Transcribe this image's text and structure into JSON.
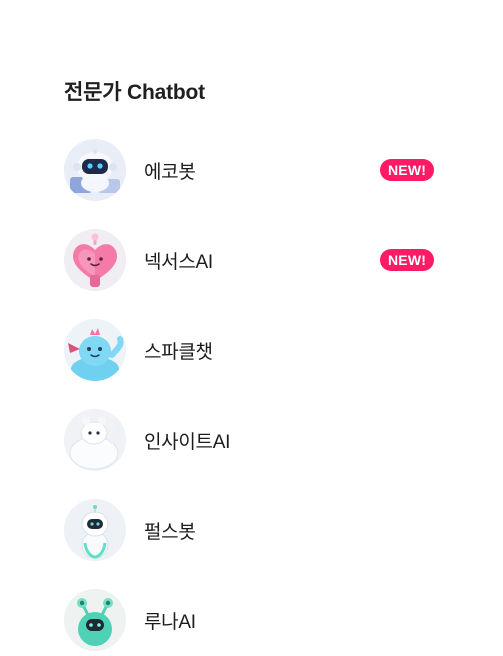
{
  "section": {
    "title": "전문가 Chatbot"
  },
  "bots": [
    {
      "name": "에코봇",
      "badge": "NEW!",
      "icon": "echobot-robot-icon"
    },
    {
      "name": "넥서스AI",
      "badge": "NEW!",
      "icon": "nexusai-pink-heart-icon"
    },
    {
      "name": "스파클챗",
      "badge": "",
      "icon": "sparklechat-blue-creature-icon"
    },
    {
      "name": "인사이트AI",
      "badge": "",
      "icon": "insightai-white-creature-icon"
    },
    {
      "name": "펄스봇",
      "badge": "",
      "icon": "pulsebot-white-robot-icon"
    },
    {
      "name": "루나AI",
      "badge": "",
      "icon": "lunaai-teal-alien-icon"
    }
  ],
  "colors": {
    "badge_background": "#ff1a66",
    "badge_text": "#ffffff",
    "title_text": "#1f1f22",
    "avatar_background": "#eef0f6"
  }
}
